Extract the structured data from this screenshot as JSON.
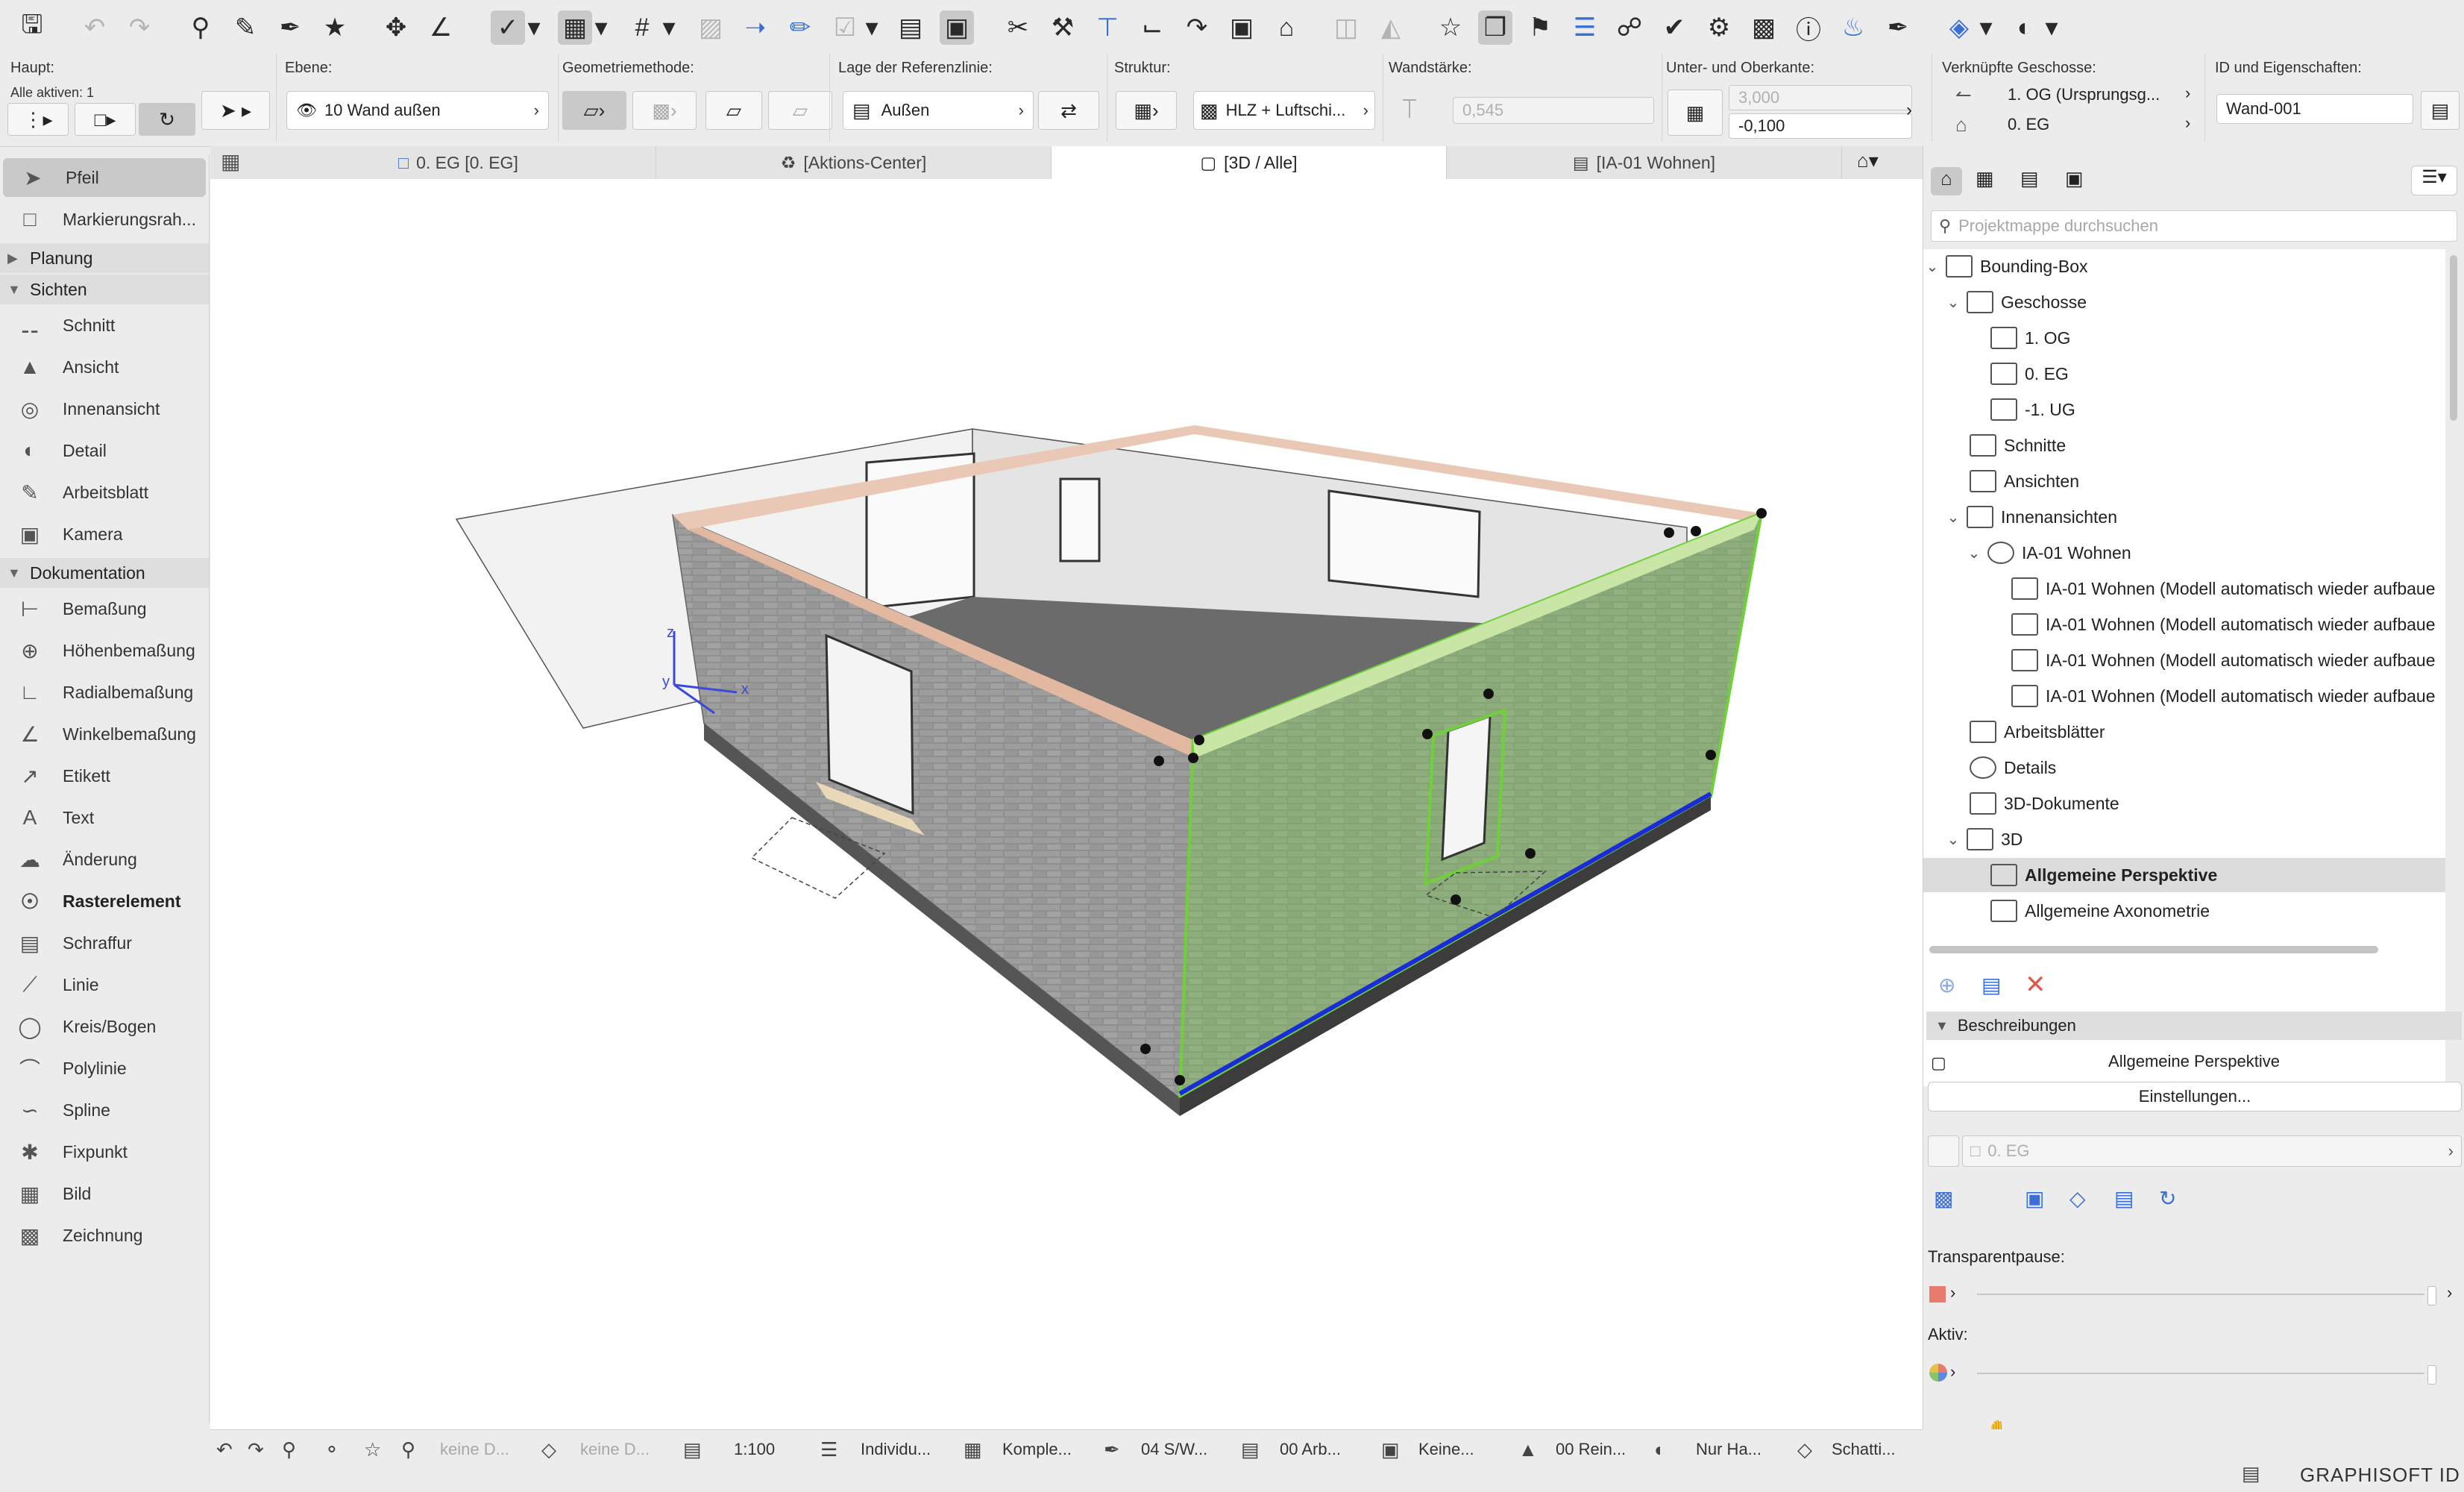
{
  "toolbar_icons": [
    "save-icon",
    "undo-icon",
    "redo-icon",
    "pick-up-icon",
    "eyedropper-icon",
    "inject-icon",
    "magic-wand-icon",
    "cross-icon",
    "angle-icon",
    "snap-guides-icon",
    "snap-points-icon",
    "grid-icon",
    "layers-icon",
    "move-icon",
    "pen-icon",
    "measure-icon",
    "selection-icon",
    "transform-icon",
    "split-icon",
    "adjust-icon",
    "intersect-icon",
    "fillet-icon",
    "offset-icon",
    "roof-icon",
    "star-icon",
    "flag-icon",
    "library-icon",
    "publish-icon",
    "render-icon",
    "teamwork-icon",
    "settings-icon"
  ],
  "info_box": {
    "haupt_label": "Haupt:",
    "alle_aktiven": "Alle aktiven: 1",
    "ebene_label": "Ebene:",
    "ebene_value": "10 Wand außen",
    "geometrie_label": "Geometriemethode:",
    "referenz_label": "Lage der Referenzlinie:",
    "referenz_value": "Außen",
    "struktur_label": "Struktur:",
    "struktur_value": "HLZ + Luftschi...",
    "wandstaerke_label": "Wandstärke:",
    "wandstaerke_value": "0,545",
    "unter_ober_label": "Unter- und Oberkante:",
    "oberkante_value": "3,000",
    "unterkante_value": "-0,100",
    "geschosse_label": "Verknüpfte Geschosse:",
    "geschoss_top": "1. OG (Ursprungsg...",
    "geschoss_bottom": "0. EG",
    "id_label": "ID und Eigenschaften:",
    "id_value": "Wand-001"
  },
  "toolbox": {
    "pfeil": "Pfeil",
    "markierung": "Markierungsrah...",
    "planung": "Planung",
    "sichten": "Sichten",
    "sichten_items": [
      "Schnitt",
      "Ansicht",
      "Innenansicht",
      "Detail",
      "Arbeitsblatt",
      "Kamera"
    ],
    "dokumentation": "Dokumentation",
    "doku_items": [
      "Bemaßung",
      "Höhenbemaßung",
      "Radialbemaßung",
      "Winkelbemaßung",
      "Etikett",
      "Text",
      "Änderung",
      "Rasterelement",
      "Schraffur",
      "Linie",
      "Kreis/Bogen",
      "Polylinie",
      "Spline",
      "Fixpunkt",
      "Bild",
      "Zeichnung"
    ]
  },
  "tabs": [
    "0. EG [0. EG]",
    "[Aktions-Center]",
    "[3D / Alle]",
    "[IA-01 Wohnen]"
  ],
  "viewport": {
    "axis_x": "x",
    "axis_y": "y",
    "axis_z": "z"
  },
  "navigator": {
    "search_placeholder": "Projektmappe durchsuchen",
    "tree": [
      "Bounding-Box",
      "Geschosse",
      "1. OG",
      "0. EG",
      "-1. UG",
      "Schnitte",
      "Ansichten",
      "Innenansichten",
      "IA-01 Wohnen",
      "IA-01 Wohnen (Modell automatisch wieder aufbaue",
      "IA-01 Wohnen (Modell automatisch wieder aufbaue",
      "IA-01 Wohnen (Modell automatisch wieder aufbaue",
      "IA-01 Wohnen (Modell automatisch wieder aufbaue",
      "Arbeitsblätter",
      "Details",
      "3D-Dokumente",
      "3D",
      "Allgemeine Perspektive",
      "Allgemeine Axonometrie"
    ]
  },
  "properties": {
    "beschreibungen": "Beschreibungen",
    "current_view": "Allgemeine Perspektive",
    "einstellungen": "Einstellungen...",
    "geschoss": "0. EG",
    "transparentpause": "Transparentpause:",
    "aktiv": "Aktiv:"
  },
  "statusbar": {
    "d1": "keine D...",
    "d2": "keine D...",
    "scale": "1:100",
    "layer": "Individu...",
    "complexity": "Komple...",
    "pen": "04 S/W...",
    "model": "00 Arb...",
    "override": "Keine...",
    "renovation": "00 Rein...",
    "half": "Nur Ha...",
    "shadow": "Schatti..."
  },
  "brand": "GRAPHISOFT ID",
  "colors": {
    "selection_green": "#6fd03a",
    "ref_line_blue": "#1a2bd8",
    "brick": "#8f8f8f",
    "floor": "#6e6e6e"
  }
}
